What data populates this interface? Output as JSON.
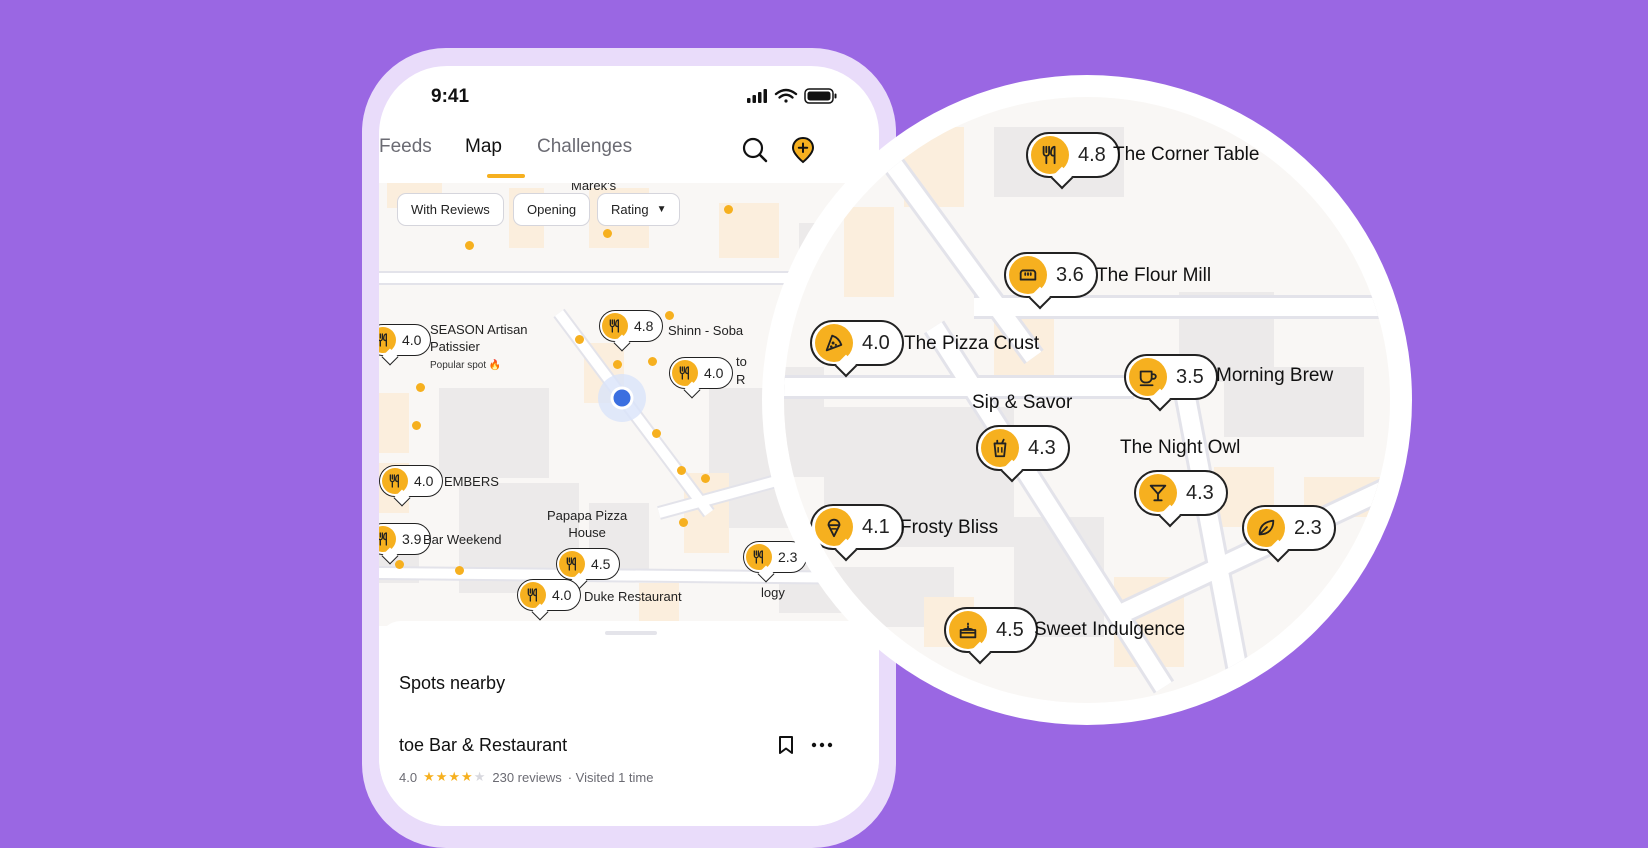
{
  "status_bar": {
    "time": "9:41"
  },
  "nav": {
    "tabs": [
      {
        "label": "Feeds"
      },
      {
        "label": "Map"
      },
      {
        "label": "Challenges"
      }
    ]
  },
  "filters": [
    {
      "label": "With Reviews"
    },
    {
      "label": "Opening"
    },
    {
      "label": "Rating"
    }
  ],
  "map": {
    "pins": [
      {
        "rating": "4.8",
        "icon": "fork-knife-icon"
      },
      {
        "rating": "4.0",
        "icon": "fork-knife-icon"
      },
      {
        "rating": "4.0",
        "icon": "fork-knife-icon"
      },
      {
        "rating": "4.0",
        "icon": "fork-knife-icon"
      },
      {
        "rating": "3.9",
        "icon": "fork-knife-icon"
      },
      {
        "rating": "4.5",
        "icon": "fork-knife-icon"
      },
      {
        "rating": "4.0",
        "icon": "fork-knife-icon"
      },
      {
        "rating": "2.3",
        "icon": "fork-knife-icon"
      }
    ],
    "labels": {
      "mareks": "Marek's",
      "season": "SEASON Artisan\nPatissier",
      "season_sub": "Popular spot 🔥",
      "shinn": "Shinn - Soba",
      "to": "to",
      "r": "R",
      "embers": "EMBERS",
      "bar_weekend": "Bar Weekend",
      "papapa": "Papapa Pizza\nHouse",
      "duke": "Duke Restaurant",
      "logy": "logy"
    }
  },
  "sheet": {
    "title": "Spots nearby",
    "place": {
      "name": "toe Bar & Restaurant",
      "rating": "4.0",
      "stars_filled": 4,
      "stars_total": 5,
      "reviews": "230 reviews",
      "visited": "· Visited 1 time"
    }
  },
  "zoom": {
    "pins": [
      {
        "name": "The Corner Table",
        "rating": "4.8",
        "icon": "fork-knife-icon"
      },
      {
        "name": "The Flour Mill",
        "rating": "3.6",
        "icon": "bread-icon"
      },
      {
        "name": "The Pizza Crust",
        "rating": "4.0",
        "icon": "pizza-icon"
      },
      {
        "name": "Morning Brew",
        "rating": "3.5",
        "icon": "coffee-cup-icon"
      },
      {
        "name": "Sip & Savor",
        "rating": "4.3",
        "icon": "drink-cup-icon"
      },
      {
        "name": "The Night Owl",
        "rating": "4.3",
        "icon": "cocktail-icon"
      },
      {
        "name": "Frosty Bliss",
        "rating": "4.1",
        "icon": "ice-cream-icon"
      },
      {
        "name": "",
        "rating": "2.3",
        "icon": "leaf-icon"
      },
      {
        "name": "Sweet Indulgence",
        "rating": "4.5",
        "icon": "cake-icon"
      }
    ]
  },
  "colors": {
    "background": "#9a67e3",
    "accent": "#f6b01f",
    "location": "#3b6fe0"
  }
}
